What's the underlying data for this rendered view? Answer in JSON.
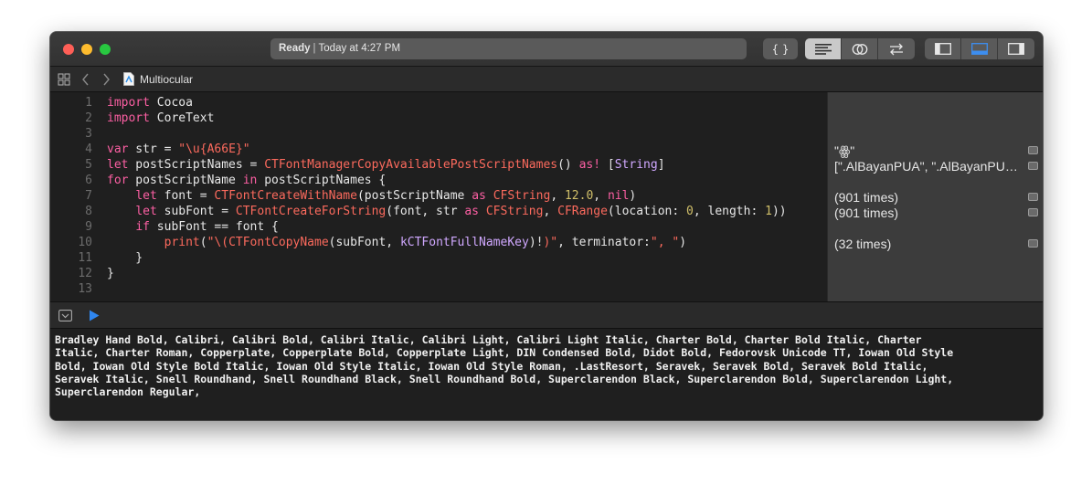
{
  "toolbar": {
    "status_ready": "Ready",
    "status_separator": "|",
    "status_time": "Today at 4:27 PM",
    "icons": [
      "braces-icon",
      "editor-lines-icon",
      "venn-icon",
      "swap-arrows-icon",
      "left-panel-icon",
      "bottom-panel-icon",
      "right-panel-icon"
    ],
    "braces_glyph": "{ }"
  },
  "jumpbar": {
    "file_name": "Multiocular"
  },
  "editor": {
    "line_numbers": [
      "1",
      "2",
      "3",
      "4",
      "5",
      "6",
      "7",
      "8",
      "9",
      "10",
      "11",
      "12",
      "13"
    ],
    "lines": [
      "import Cocoa",
      "import CoreText",
      "",
      "var str = \"\\u{A66E}\"",
      "let postScriptNames = CTFontManagerCopyAvailablePostScriptNames() as! [String]",
      "for postScriptName in postScriptNames {",
      "    let font = CTFontCreateWithName(postScriptName as CFString, 12.0, nil)",
      "    let subFont = CTFontCreateForString(font, str as CFString, CFRange(location: 0, length: 1))",
      "    if subFont == font {",
      "        print(\"\\(CTFontCopyName(subFont, kCTFontFullNameKey)!)\", terminator:\", \")",
      "    }",
      "}",
      ""
    ]
  },
  "results": {
    "line4": "\"ꙮ\"",
    "line5": "[\".AlBayanPUA\", \".AlBayanPUA\", \".AlBayanPUA\"]",
    "line7": "(901 times)",
    "line8": "(901 times)",
    "line10": "(32 times)"
  },
  "console": {
    "output": "Bradley Hand Bold, Calibri, Calibri Bold, Calibri Italic, Calibri Light, Calibri Light Italic, Charter Bold, Charter Bold Italic, Charter\nItalic, Charter Roman, Copperplate, Copperplate Bold, Copperplate Light, DIN Condensed Bold, Didot Bold, Fedorovsk Unicode TT, Iowan Old Style\nBold, Iowan Old Style Bold Italic, Iowan Old Style Italic, Iowan Old Style Roman, .LastResort, Seravek, Seravek Bold, Seravek Bold Italic,\nSeravek Italic, Snell Roundhand, Snell Roundhand Black, Snell Roundhand Bold, Superclarendon Black, Superclarendon Bold, Superclarendon Light,\nSuperclarendon Regular,"
  }
}
